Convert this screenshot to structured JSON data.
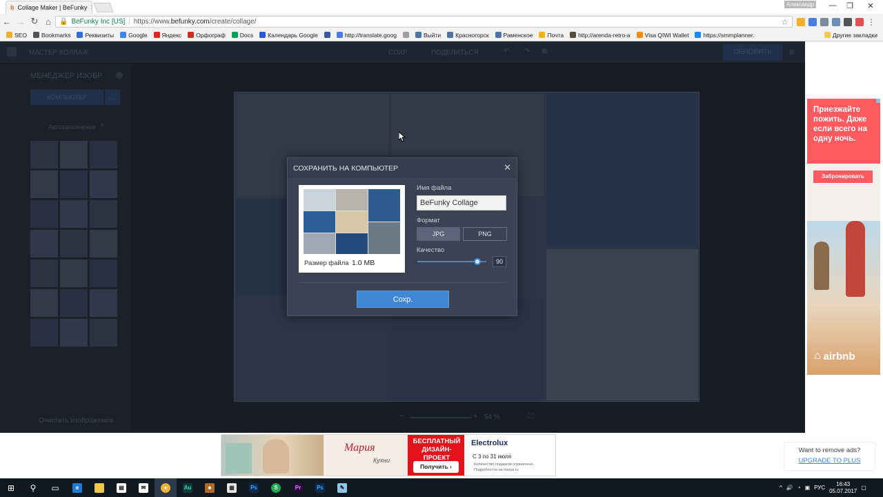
{
  "browser": {
    "tab_title": "Collage Maker | BeFunky",
    "user_name": "Александр",
    "secure_label": "BeFunky Inc [US]",
    "url_prefix": "https://www.",
    "url_domain": "befunky.com",
    "url_path": "/create/collage/",
    "bookmarks": [
      {
        "label": "SEO",
        "color": "#f2b12a"
      },
      {
        "label": "Bookmarks",
        "color": "#555555"
      },
      {
        "label": "Реквизиты",
        "color": "#2f6fd6"
      },
      {
        "label": "Google",
        "color": "#4285f4"
      },
      {
        "label": "Яндекс",
        "color": "#e52620"
      },
      {
        "label": "Орфограф",
        "color": "#d62d20"
      },
      {
        "label": "Docs",
        "color": "#0f9d58"
      },
      {
        "label": "Календарь Google",
        "color": "#2a5bd7"
      },
      {
        "label": "",
        "color": "#3b5998"
      },
      {
        "label": "http://translate.goog",
        "color": "#4a7fe0"
      },
      {
        "label": "",
        "color": "#9e9e9e"
      },
      {
        "label": "Выйти",
        "color": "#4c75a3"
      },
      {
        "label": "Красногорск",
        "color": "#4c75a3"
      },
      {
        "label": "Раменское",
        "color": "#4c75a3"
      },
      {
        "label": "Почта",
        "color": "#f4b400"
      },
      {
        "label": "http://arenda-retro-a",
        "color": "#5a4a3a"
      },
      {
        "label": "Visa QIWI Wallet",
        "color": "#ff8c00"
      },
      {
        "label": "https://smmplanner.",
        "color": "#1e88e5"
      }
    ],
    "other_bookmarks": "Другие закладки"
  },
  "app": {
    "top_left_label": "МАСТЕР КОЛЛАЖ",
    "top_save": "СОХР.",
    "top_share": "ПОДЕЛИТЬСЯ",
    "top_right_button": "ОБНОВИТЬ",
    "panel_title": "МЕНЕДЖЕР ИЗОБР.",
    "computer_button": "КОМПЬЮТЕР",
    "autofill_label": "Автозаполнение",
    "clear_label": "Очистить изображения",
    "zoom_value": "54 %"
  },
  "dialog": {
    "title": "СОХРАНИТЬ НА КОМПЬЮТЕР",
    "close_icon": "close-icon",
    "file_size_label": "Размер файла",
    "file_size_value": "1.0 MB",
    "filename_label": "Имя файла",
    "filename_value": "BeFunky Collage",
    "format_label": "Формат",
    "format_options": [
      "JPG",
      "PNG"
    ],
    "format_selected": "JPG",
    "quality_label": "Качество",
    "quality_value": "90",
    "quality_fraction": 0.9,
    "save_button": "Сохр."
  },
  "ads": {
    "right_text": "Приезжайте пожить. Даже если всего на одну ночь.",
    "right_button": "Забронировать",
    "right_brand": "airbnb",
    "banner_brand": "Мария",
    "banner_brand_sub": "Кухни",
    "banner_offer": "БЕСПЛАТНЫЙ ДИЗАЙН-ПРОЕКТ",
    "banner_cta": "Получить",
    "banner_partner": "Electrolux",
    "banner_dates": "С 3 по 31 июля",
    "banner_fine1": "Количество подарков ограничено.",
    "banner_fine2": "Подробности на marya.ru",
    "remove_ads": "Want to remove ads?",
    "upgrade": "UPGRADE TO PLUS"
  },
  "taskbar": {
    "lang": "РУС",
    "time": "16:43",
    "date": "05.07.2017"
  },
  "colors": {
    "accent": "#3f87d3",
    "airbnb": "#ff5a5f",
    "dialog_bg": "#3a4254"
  }
}
